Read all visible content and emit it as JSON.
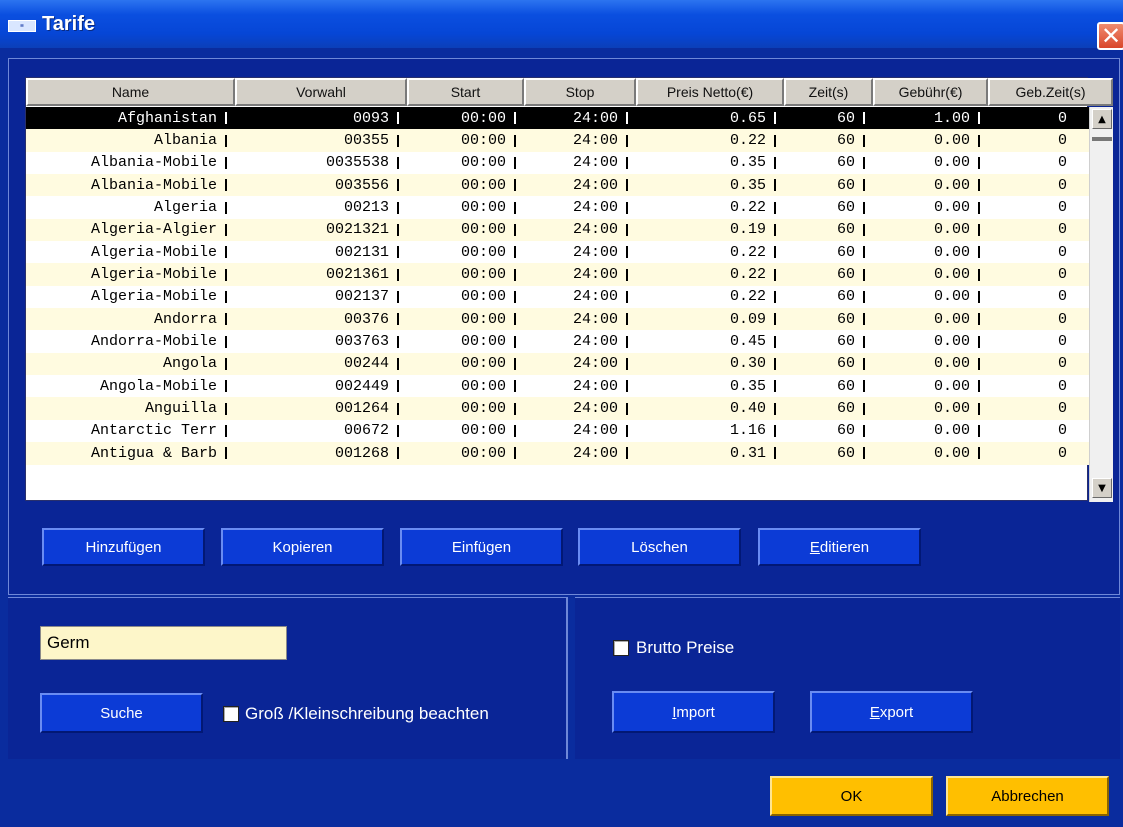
{
  "window": {
    "title": "Tarife",
    "icon": "app-logo-icon",
    "close_icon": "close-icon"
  },
  "table": {
    "columns": [
      "Name",
      "Vorwahl",
      "Start",
      "Stop",
      "Preis Netto(€)",
      "Zeit(s)",
      "Gebühr(€)",
      "Geb.Zeit(s)"
    ],
    "rows": [
      [
        "Afghanistan",
        "0093",
        "00:00",
        "24:00",
        "0.65",
        "60",
        "1.00",
        "0"
      ],
      [
        "Albania",
        "00355",
        "00:00",
        "24:00",
        "0.22",
        "60",
        "0.00",
        "0"
      ],
      [
        "Albania-Mobile",
        "0035538",
        "00:00",
        "24:00",
        "0.35",
        "60",
        "0.00",
        "0"
      ],
      [
        "Albania-Mobile",
        "003556",
        "00:00",
        "24:00",
        "0.35",
        "60",
        "0.00",
        "0"
      ],
      [
        "Algeria",
        "00213",
        "00:00",
        "24:00",
        "0.22",
        "60",
        "0.00",
        "0"
      ],
      [
        "Algeria-Algier",
        "0021321",
        "00:00",
        "24:00",
        "0.19",
        "60",
        "0.00",
        "0"
      ],
      [
        "Algeria-Mobile",
        "002131",
        "00:00",
        "24:00",
        "0.22",
        "60",
        "0.00",
        "0"
      ],
      [
        "Algeria-Mobile",
        "0021361",
        "00:00",
        "24:00",
        "0.22",
        "60",
        "0.00",
        "0"
      ],
      [
        "Algeria-Mobile",
        "002137",
        "00:00",
        "24:00",
        "0.22",
        "60",
        "0.00",
        "0"
      ],
      [
        "Andorra",
        "00376",
        "00:00",
        "24:00",
        "0.09",
        "60",
        "0.00",
        "0"
      ],
      [
        "Andorra-Mobile",
        "003763",
        "00:00",
        "24:00",
        "0.45",
        "60",
        "0.00",
        "0"
      ],
      [
        "Angola",
        "00244",
        "00:00",
        "24:00",
        "0.30",
        "60",
        "0.00",
        "0"
      ],
      [
        "Angola-Mobile",
        "002449",
        "00:00",
        "24:00",
        "0.35",
        "60",
        "0.00",
        "0"
      ],
      [
        "Anguilla",
        "001264",
        "00:00",
        "24:00",
        "0.40",
        "60",
        "0.00",
        "0"
      ],
      [
        "Antarctic Terr",
        "00672",
        "00:00",
        "24:00",
        "1.16",
        "60",
        "0.00",
        "0"
      ],
      [
        "Antigua & Barb",
        "001268",
        "00:00",
        "24:00",
        "0.31",
        "60",
        "0.00",
        "0"
      ]
    ],
    "selected_row": 0
  },
  "actions": {
    "add": "Hinzufügen",
    "copy": "Kopieren",
    "paste": "Einfügen",
    "delete": "Löschen",
    "edit_prefix": "E",
    "edit_rest": "ditieren"
  },
  "search": {
    "value": "Germ",
    "button": "Suche",
    "case_label": "Groß /Kleinschreibung beachten"
  },
  "options": {
    "gross_prices_label": "Brutto Preise",
    "import_prefix": "I",
    "import_rest": "mport",
    "export_prefix": "E",
    "export_rest": "xport"
  },
  "footer": {
    "ok": "OK",
    "cancel": "Abbrechen"
  },
  "colors": {
    "window_bg": "#0a2c9e",
    "button_blue": "#0c3bd6",
    "button_yellow": "#ffbf00",
    "row_alt": "#fffbe0"
  }
}
